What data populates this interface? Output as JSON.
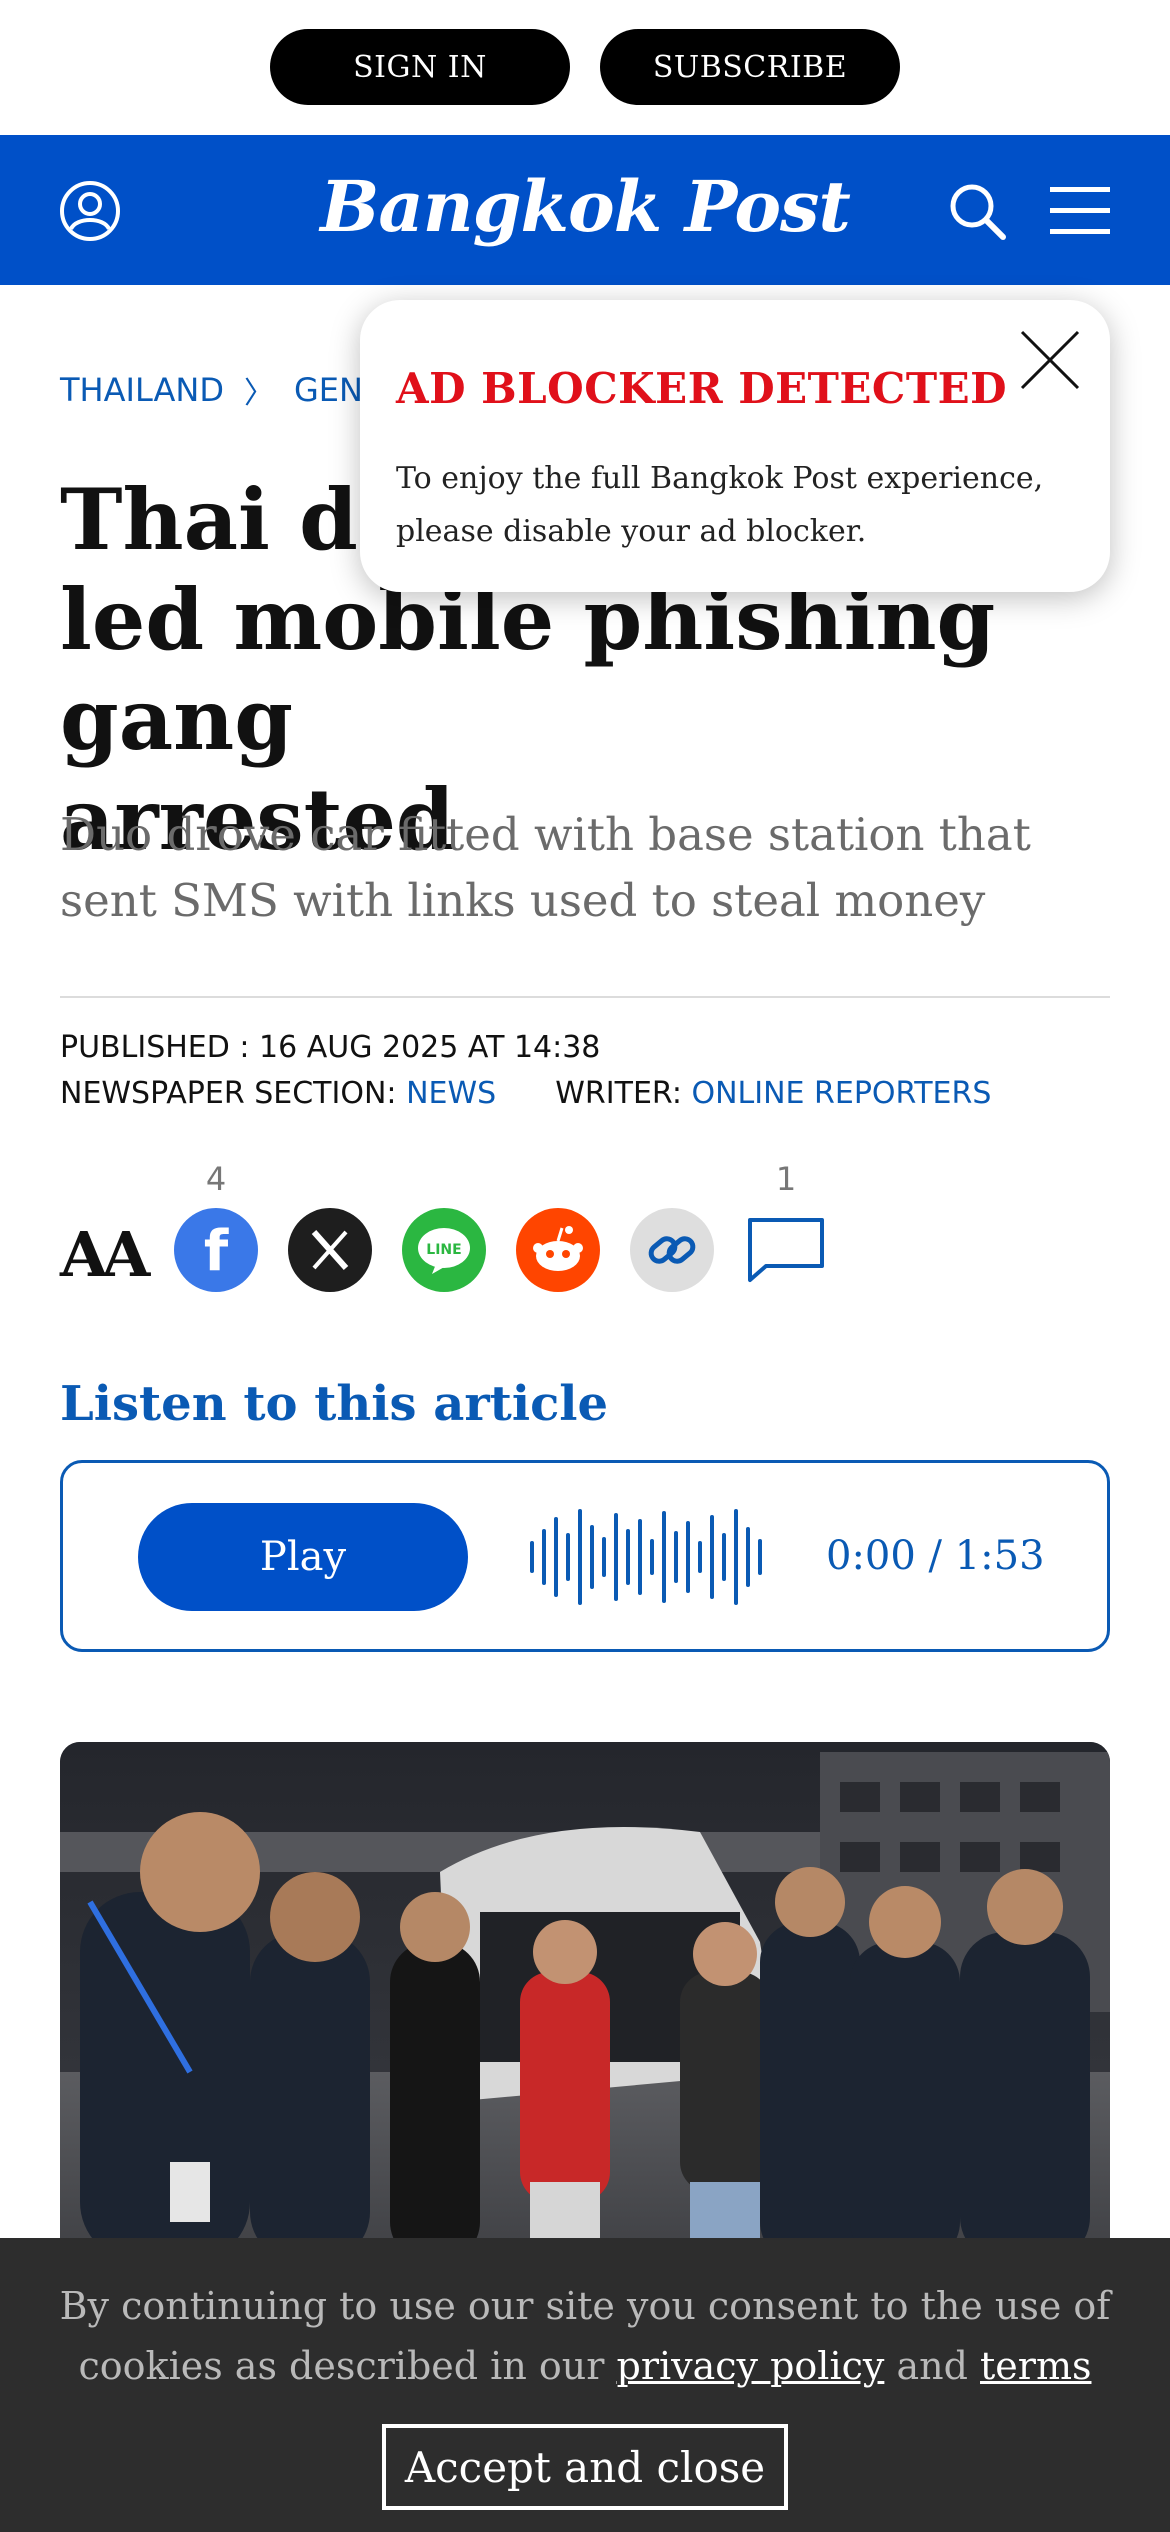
{
  "account_bar": {
    "sign_in": "SIGN IN",
    "subscribe": "SUBSCRIBE"
  },
  "header": {
    "logo": "Bangkok Post",
    "icons": [
      "user-icon",
      "search-icon",
      "menu-icon"
    ],
    "brand_color": "#0050c8"
  },
  "breadcrumb": {
    "items": [
      "THAILAND",
      "GEN"
    ]
  },
  "article": {
    "headline": "Thai dri led mobile phishing gang arrested",
    "headline_visible_line1": "Thai dri",
    "headline_visible_line2": "led mobile phishing gang",
    "headline_visible_line3": "arrested",
    "subhead": "Duo drove car fitted with base station that sent SMS with links used to steal money",
    "published": "PUBLISHED : 16 AUG 2025 AT 14:38",
    "section_label": "NEWSPAPER SECTION:",
    "section_value": "NEWS",
    "writer_label": "WRITER:",
    "writer_value": "ONLINE REPORTERS"
  },
  "share": {
    "font_size_label": "AA",
    "facebook_count": "4",
    "comments_count": "1",
    "buttons": [
      "facebook-icon",
      "x-icon",
      "line-icon",
      "reddit-icon",
      "link-icon",
      "comment-icon"
    ]
  },
  "listen": {
    "title": "Listen to this article",
    "play_label": "Play",
    "time": "0:00 / 1:53"
  },
  "ad_popup": {
    "title": "AD BLOCKER DETECTED",
    "text": "To enjoy the full Bangkok Post experience, please disable your ad blocker."
  },
  "cookie_banner": {
    "text_before": "By continuing to use our site you consent to the use of cookies as described in our",
    "privacy_link": "privacy policy",
    "and": "and",
    "terms_link": "terms",
    "button": "Accept and close"
  }
}
